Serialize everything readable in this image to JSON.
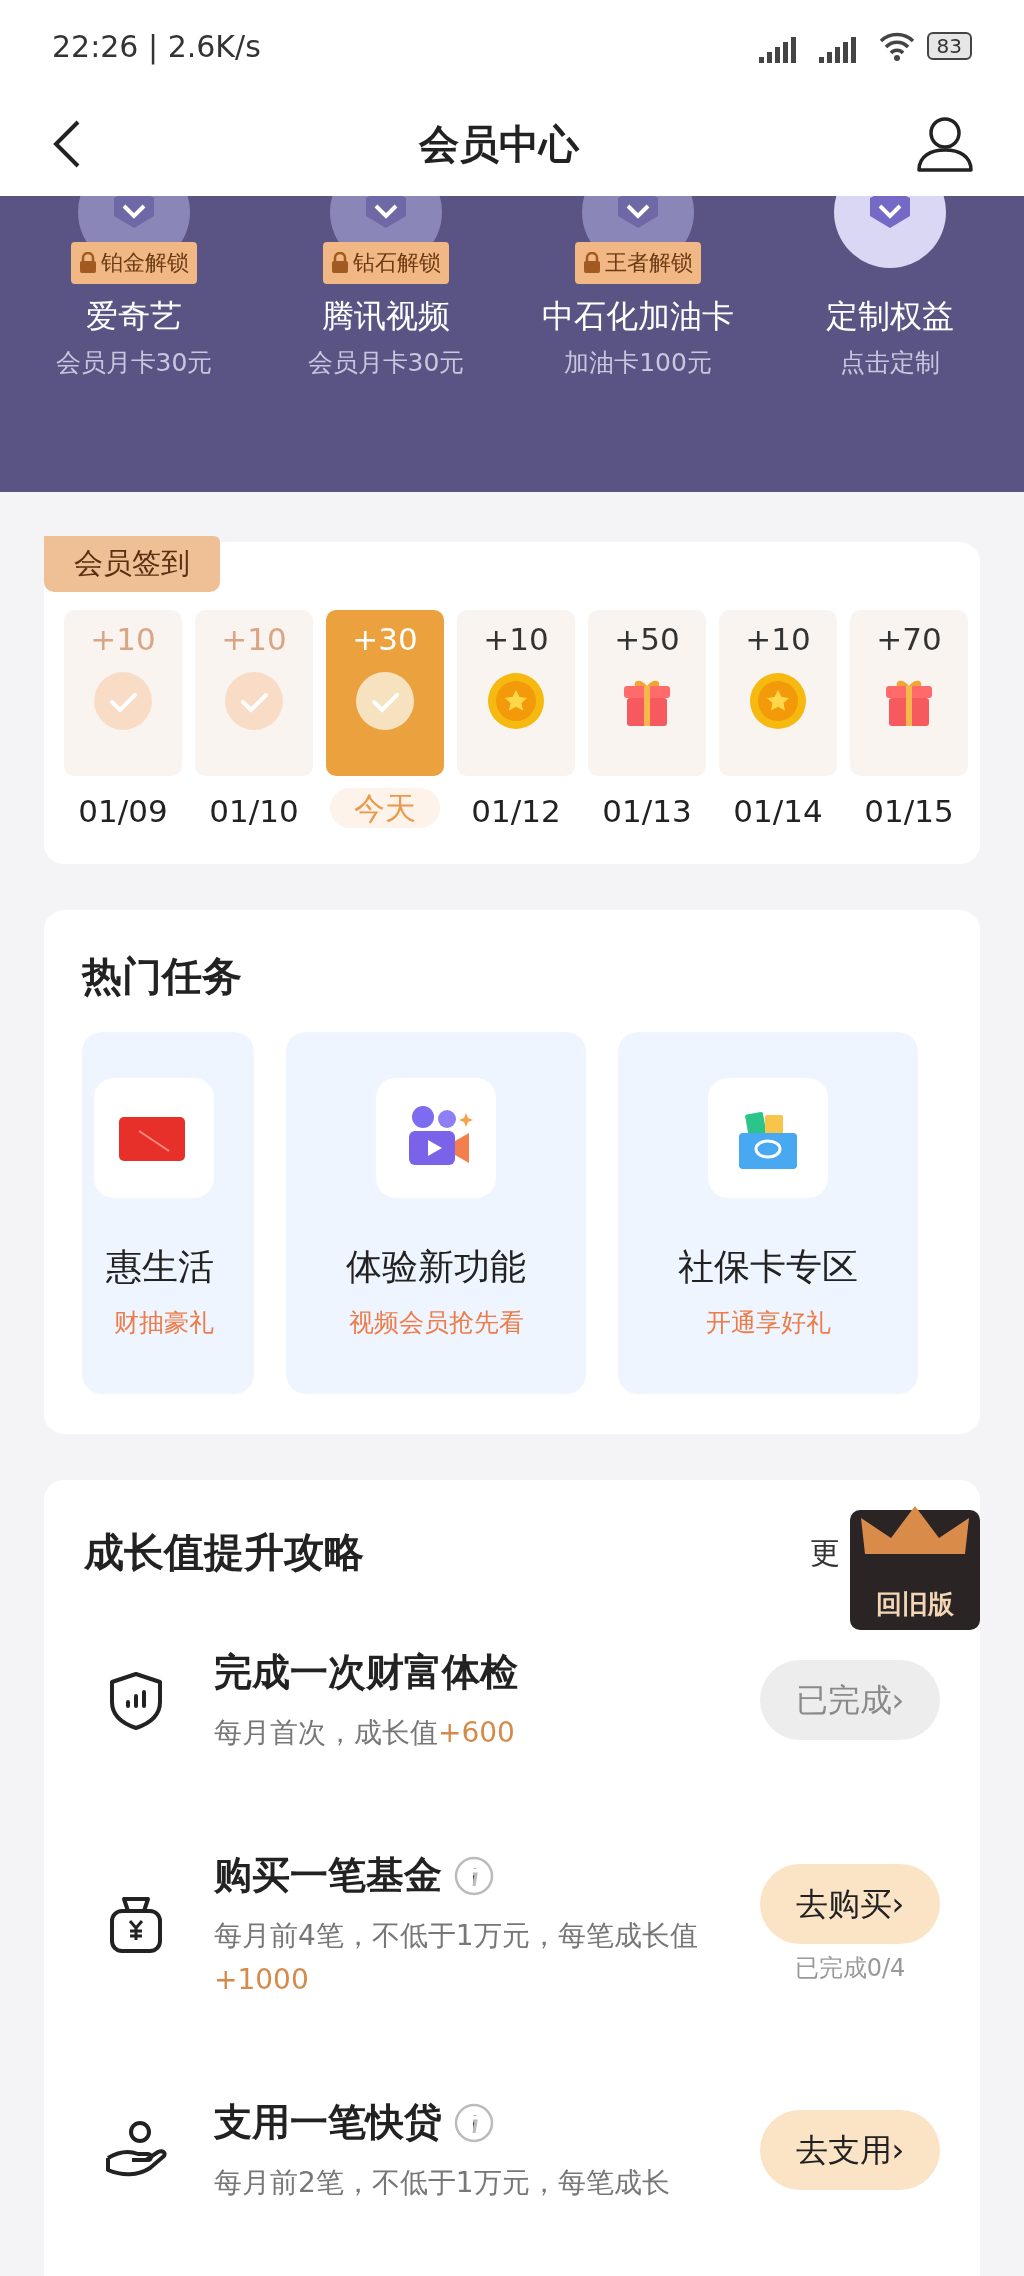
{
  "status_bar": {
    "time": "22:26 | 2.6K/s",
    "battery": "83"
  },
  "header": {
    "title": "会员中心"
  },
  "benefits": [
    {
      "name": "爱奇艺",
      "sub": "会员月卡30元",
      "lock": "铂金解锁"
    },
    {
      "name": "腾讯视频",
      "sub": "会员月卡30元",
      "lock": "钻石解锁"
    },
    {
      "name": "中石化加油卡",
      "sub": "加油卡100元",
      "lock": "王者解锁"
    },
    {
      "name": "定制权益",
      "sub": "点击定制"
    }
  ],
  "checkin": {
    "title": "会员签到",
    "days": [
      {
        "points": "+10",
        "date": "01/09",
        "kind": "done",
        "selected": false
      },
      {
        "points": "+10",
        "date": "01/10",
        "kind": "done",
        "selected": false
      },
      {
        "points": "+30",
        "date": "今天",
        "kind": "done",
        "selected": true
      },
      {
        "points": "+10",
        "date": "01/12",
        "kind": "coin",
        "selected": false
      },
      {
        "points": "+50",
        "date": "01/13",
        "kind": "gift",
        "selected": false
      },
      {
        "points": "+10",
        "date": "01/14",
        "kind": "coin",
        "selected": false
      },
      {
        "points": "+70",
        "date": "01/15",
        "kind": "gift",
        "selected": false
      }
    ]
  },
  "hot_tasks": {
    "title": "热门任务",
    "items": [
      {
        "name": "惠生活",
        "sub": "财抽豪礼",
        "kind": "card"
      },
      {
        "name": "体验新功能",
        "sub": "视频会员抢先看",
        "kind": "video"
      },
      {
        "name": "社保卡专区",
        "sub": "开通享好礼",
        "kind": "wallet"
      }
    ]
  },
  "growth": {
    "title": "成长值提升攻略",
    "more": "更",
    "float_badge": "回旧版",
    "items": [
      {
        "kind": "shield",
        "title": "完成一次财富体检",
        "desc": "每月首次，成长值",
        "bonus": "+600",
        "button": "已完成",
        "chevron": "›",
        "done": true,
        "info": false
      },
      {
        "kind": "bag",
        "title": "购买一笔基金",
        "desc": "每月前4笔，不低于1万元，每笔成长值",
        "bonus": "+1000",
        "button": "去购买",
        "chevron": "›",
        "done": false,
        "info": true,
        "progress": "已完成0/4"
      },
      {
        "kind": "hand",
        "title": "支用一笔快贷",
        "desc": "每月前2笔，不低于1万元，每笔成长",
        "button": "去支用",
        "chevron": "›",
        "done": false,
        "info": true
      }
    ]
  }
}
